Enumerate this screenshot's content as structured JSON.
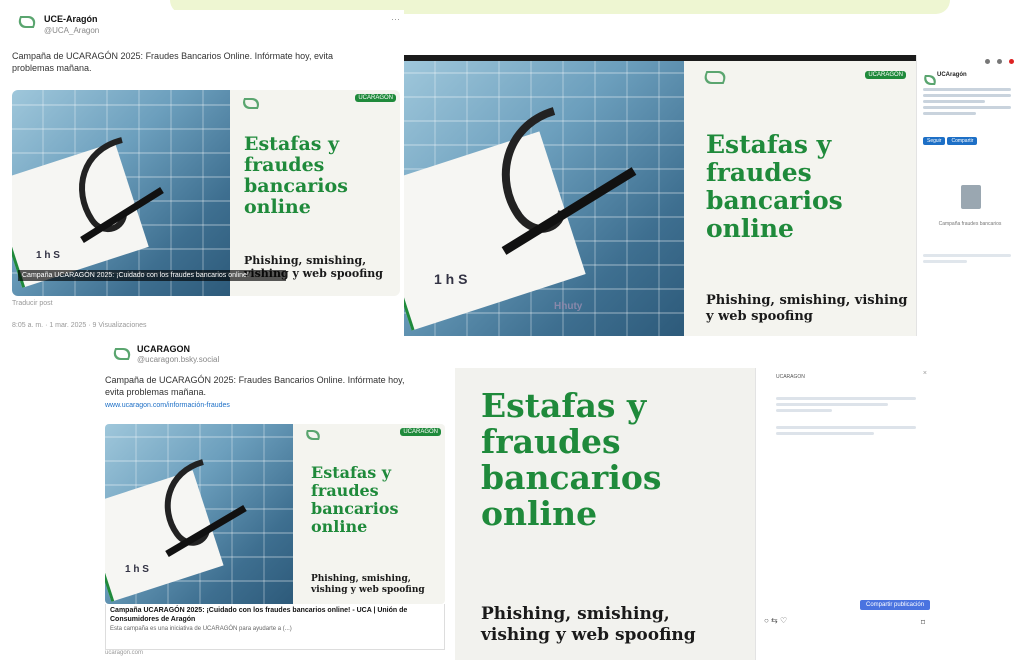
{
  "colors": {
    "accent": "#1f8a3b",
    "background": "#ffffff"
  },
  "tweet1": {
    "name": "UCE-Aragón",
    "handle": "@UCA_Aragon",
    "text": "Campaña de UCARAGÓN 2025: Fraudes Bancarios Online. Infórmate hoy, evita problemas mañana.",
    "image_caption": "Campaña UCARAGÓN 2025: ¡Cuidado con los fraudes bancarios online!",
    "promo": {
      "title": "Estafas y fraudes bancarios online",
      "subtitle": "Phishing, smishing, vishing y web spoofing",
      "chip": "UCARAGÓN"
    },
    "footer": "8:05 a. m. · 1 mar. 2025 · 9 Visualizaciones"
  },
  "viewer": {
    "promo": {
      "title": "Estafas y fraudes bancarios online",
      "subtitle": "Phishing, smishing, vishing y web spoofing",
      "chip": "UCARAGÓN"
    },
    "card_text": "Hhuty",
    "sidebar": {
      "name": "UCAragón",
      "btn1": "Seguir",
      "btn2": "Compartir",
      "doc_caption": "Campaña fraudes bancarios"
    }
  },
  "tweet2": {
    "name": "UCARAGON",
    "handle": "@ucaragon.bsky.social",
    "text": "Campaña de UCARAGÓN 2025: Fraudes Bancarios Online. Infórmate hoy, evita problemas mañana.",
    "link": "www.ucaragon.com/información-fraudes",
    "promo": {
      "title": "Estafas y fraudes bancarios online",
      "subtitle": "Phishing, smishing, vishing y web spoofing",
      "chip": "UCARAGÓN"
    },
    "link_card_title": "Campaña UCARAGÓN 2025: ¡Cuidado con los fraudes bancarios online! - UCA | Unión de Consumidores de Aragón",
    "link_card_desc": "Esta campaña es una iniciativa de UCARAGÓN para ayudarte a (...)",
    "link_card_domain": "ucaragon.com"
  },
  "bigpost": {
    "promo": {
      "title": "Estafas y fraudes bancarios online",
      "subtitle": "Phishing, smishing, vishing y web spoofing"
    },
    "sidebar": {
      "name": "UCARAGON",
      "action": "Compartir publicación"
    }
  }
}
